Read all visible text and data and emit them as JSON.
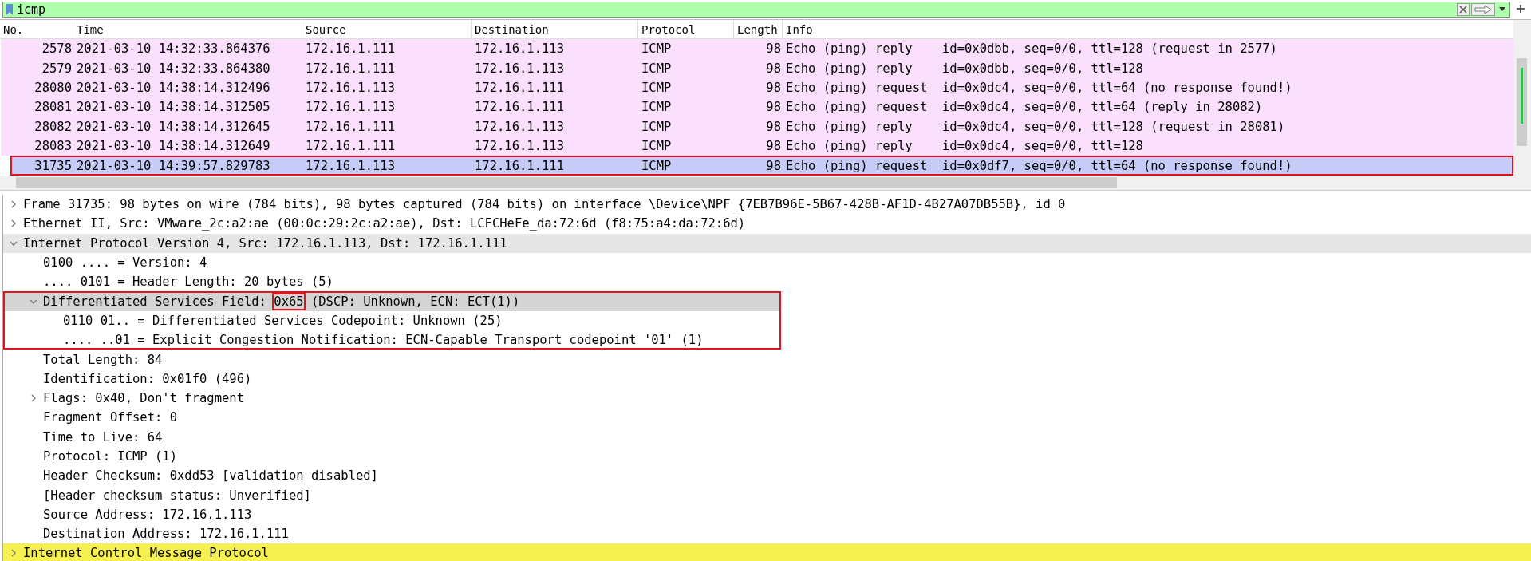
{
  "filter": {
    "value": "icmp"
  },
  "columns": [
    "No.",
    "Time",
    "Source",
    "Destination",
    "Protocol",
    "Length",
    "Info"
  ],
  "packets": [
    {
      "cells": [
        "2578",
        "2021-03-10 14:32:33.864376",
        "172.16.1.111",
        "172.16.1.113",
        "ICMP",
        "98",
        "Echo (ping) reply    id=0x0dbb, seq=0/0, ttl=128 (request in 2577)"
      ],
      "selected": false,
      "outlined": false
    },
    {
      "cells": [
        "2579",
        "2021-03-10 14:32:33.864380",
        "172.16.1.111",
        "172.16.1.113",
        "ICMP",
        "98",
        "Echo (ping) reply    id=0x0dbb, seq=0/0, ttl=128"
      ],
      "selected": false,
      "outlined": false
    },
    {
      "cells": [
        "28080",
        "2021-03-10 14:38:14.312496",
        "172.16.1.113",
        "172.16.1.111",
        "ICMP",
        "98",
        "Echo (ping) request  id=0x0dc4, seq=0/0, ttl=64 (no response found!)"
      ],
      "selected": false,
      "outlined": false
    },
    {
      "cells": [
        "28081",
        "2021-03-10 14:38:14.312505",
        "172.16.1.113",
        "172.16.1.111",
        "ICMP",
        "98",
        "Echo (ping) request  id=0x0dc4, seq=0/0, ttl=64 (reply in 28082)"
      ],
      "selected": false,
      "outlined": false
    },
    {
      "cells": [
        "28082",
        "2021-03-10 14:38:14.312645",
        "172.16.1.111",
        "172.16.1.113",
        "ICMP",
        "98",
        "Echo (ping) reply    id=0x0dc4, seq=0/0, ttl=128 (request in 28081)"
      ],
      "selected": false,
      "outlined": false
    },
    {
      "cells": [
        "28083",
        "2021-03-10 14:38:14.312649",
        "172.16.1.111",
        "172.16.1.113",
        "ICMP",
        "98",
        "Echo (ping) reply    id=0x0dc4, seq=0/0, ttl=128"
      ],
      "selected": false,
      "outlined": false
    },
    {
      "cells": [
        "31735",
        "2021-03-10 14:39:57.829783",
        "172.16.1.113",
        "172.16.1.111",
        "ICMP",
        "98",
        "Echo (ping) request  id=0x0df7, seq=0/0, ttl=64 (no response found!)"
      ],
      "selected": true,
      "outlined": true
    }
  ],
  "details": [
    {
      "text": "Frame 31735: 98 bytes on wire (784 bits), 98 bytes captured (784 bits) on interface \\Device\\NPF_{7EB7B96E-5B67-428B-AF1D-4B27A07DB55B}, id 0",
      "expanded": false,
      "selected": false
    },
    {
      "text": "Ethernet II, Src: VMware_2c:a2:ae (00:0c:29:2c:a2:ae), Dst: LCFCHeFe_da:72:6d (f8:75:a4:da:72:6d)",
      "expanded": false,
      "selected": false
    },
    {
      "text": "Internet Protocol Version 4, Src: 172.16.1.113, Dst: 172.16.1.111",
      "expanded": true,
      "selected": false,
      "color": "#e6e6e6",
      "children": [
        {
          "text": "0100 .... = Version: 4",
          "selected": false
        },
        {
          "text": ".... 0101 = Header Length: 20 bytes (5)",
          "selected": false
        },
        {
          "text": "Differentiated Services Field: ",
          "boxed": "0x65",
          "rest": " (DSCP: Unknown, ECN: ECT(1))",
          "expanded": true,
          "selected": true,
          "outlined": true,
          "children": [
            {
              "text": "0110 01.. = Differentiated Services Codepoint: Unknown (25)",
              "selected": false
            },
            {
              "text": ".... ..01 = Explicit Congestion Notification: ECN-Capable Transport codepoint '01' (1)",
              "selected": false
            }
          ]
        },
        {
          "text": "Total Length: 84",
          "selected": false
        },
        {
          "text": "Identification: 0x01f0 (496)",
          "selected": false
        },
        {
          "text": "Flags: 0x40, Don't fragment",
          "expanded": false,
          "selected": false
        },
        {
          "text": "Fragment Offset: 0",
          "selected": false
        },
        {
          "text": "Time to Live: 64",
          "selected": false
        },
        {
          "text": "Protocol: ICMP (1)",
          "selected": false
        },
        {
          "text": "Header Checksum: 0xdd53 [validation disabled]",
          "selected": false
        },
        {
          "text": "[Header checksum status: Unverified]",
          "selected": false
        },
        {
          "text": "Source Address: 172.16.1.113",
          "selected": false
        },
        {
          "text": "Destination Address: 172.16.1.111",
          "selected": false
        }
      ]
    },
    {
      "text": "Internet Control Message Protocol",
      "expanded": false,
      "selected": false,
      "color": "#f6f151"
    }
  ]
}
